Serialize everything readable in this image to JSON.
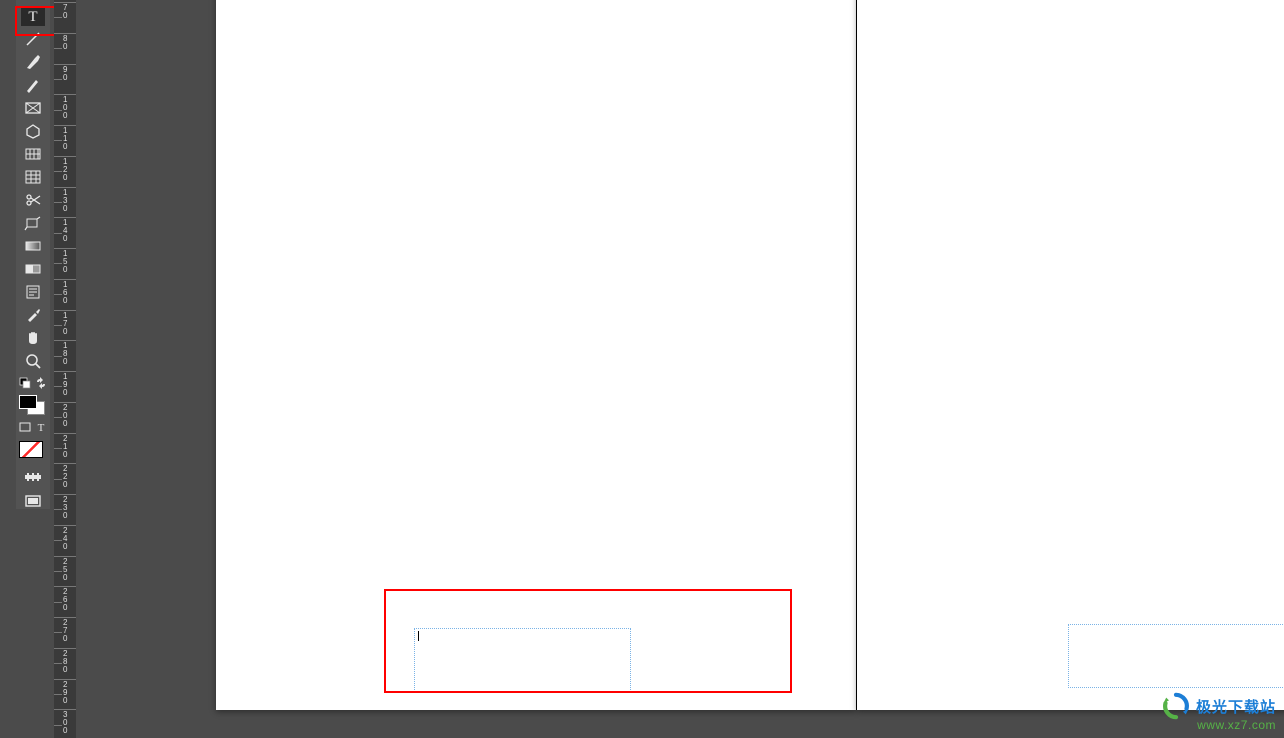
{
  "ruler": {
    "labels": [
      "70",
      "80",
      "90",
      "100",
      "110",
      "120",
      "130",
      "140",
      "150",
      "160",
      "170",
      "180",
      "190",
      "200",
      "210",
      "220",
      "230",
      "240",
      "250",
      "260",
      "270",
      "280",
      "290",
      "300"
    ]
  },
  "watermark": {
    "line1": "极光下载站",
    "line2": "www.xz7.com"
  },
  "tools": {
    "text": "T",
    "frame_text": "T"
  }
}
